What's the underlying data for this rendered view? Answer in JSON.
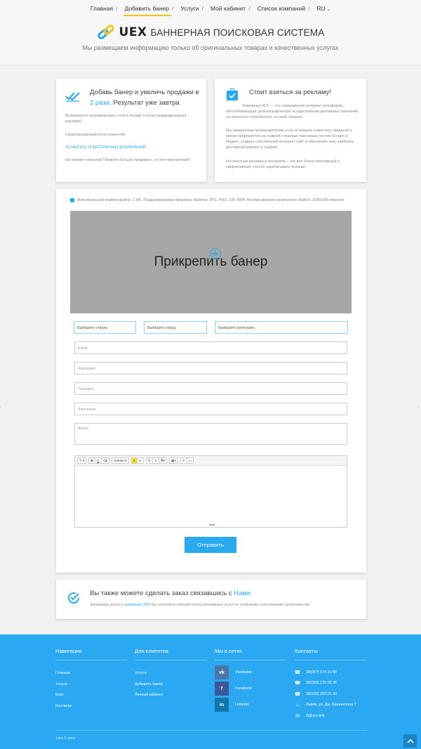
{
  "nav": {
    "items": [
      "Главная",
      "Добавить банер",
      "Услуги",
      "Мой кабинет",
      "Список компаний"
    ],
    "lang": "RU"
  },
  "logo": {
    "brand": "UEX",
    "title": "БАННЕРНАЯ ПОИСКОВАЯ СИСТЕМА"
  },
  "tagline": "Мы размещаем информацию только об оригинальных товарах и качественных услугах",
  "card_left": {
    "title_line1": "Добавь банер и увеличь продажи в",
    "title_accent": "2 раза.",
    "title_line2": " Результат уже завтра",
    "p1": "Возможность рекламировать себя в Google (только индивидуальная реклама)",
    "p2": "Гарантированный поток клиентов!",
    "link": "ОСТАЛОСЬ 15 БЕСПЛАТНЫХ ДОБАВЛЕНИЙ",
    "p3": "Не хватает клиентов? Можете больше продавать, но нет покупателей?"
  },
  "card_right": {
    "title": "Стоит взяться за рекламу!",
    "p1": "Компания UEX — это современная интернет платформа, обеспечивающая целенаправленное осуществление рекламных кампаний на конечного потребителя, по всей Украине.",
    "p2": "Мы предлагаем производителям услуг и товаров поместить сведения о своем предприятии на главной странице поисковых систем Google и Яндекс, создать собственный интернет сайт и обеспечить ему наиболее достойный рейтинг и трафик!",
    "p3": "Контекстная реклама в интернете – это все более популярный и эффективный, способ зарабатывать больше!"
  },
  "form": {
    "upload_hint": "Максимальный размер файла: 1 МБ. Поддерживаемые форматы файлов: JPG, PNG, GIF, BMP. Рекомендуемое разрешение файла: 1090x365 пиксели",
    "drop_text": "Прикрепить банер",
    "select_country": "Выберите страну",
    "select_city": "Выберите город",
    "select_category": "Выберите категорию",
    "email_ph": "Email",
    "company_ph": "Компания",
    "phone_ph": "Телефон",
    "heading_ph": "Заголовок",
    "announce_ph": "Анонс",
    "toolbar": {
      "font": "Roboto"
    },
    "submit": "Отправить"
  },
  "contact": {
    "title": "Вы также можете сделать заказ связавшись с ",
    "title_link": "Нами",
    "text_pre": "Заказывая услугу у ",
    "text_link": "компании UEX",
    "text_post": " Вы получаете полный спектр рекламных услуг по отличному соотношению цена/качество"
  },
  "footer": {
    "nav_head": "Навигация",
    "nav_links": [
      "Главная",
      "Услуги",
      "Блог",
      "Контакты"
    ],
    "clients_head": "Для клиентов",
    "clients_links": [
      "Услуги",
      "Добавить банер",
      "Личный кабинет"
    ],
    "social_head": "Мы в сетях",
    "social": [
      {
        "label": "Vkontakte",
        "icon": "vk-icon",
        "color": "#4a76a8"
      },
      {
        "label": "Facebook",
        "icon": "facebook-icon",
        "color": "#3b5998"
      },
      {
        "label": "Linkedin",
        "icon": "linkedin-icon",
        "color": "#0e76a8"
      }
    ],
    "contacts_head": "Контакты",
    "phones": [
      "38(067) 574 21 88",
      "38(093) 170 05 96",
      "38(032) 253 01 40"
    ],
    "address": "Львов, ул. Дж. Вашингтона 7",
    "email": "it@uex.link",
    "copyright": "UEX © 2015"
  },
  "colors": {
    "accent": "#29a9ee",
    "footer": "#2aa8f2",
    "logo_yellow": "#f5c518"
  }
}
